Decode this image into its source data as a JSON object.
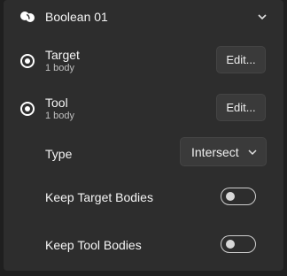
{
  "header": {
    "title": "Boolean 01",
    "icon": "boolean-shapes-icon",
    "collapse_icon": "chevron-down-icon"
  },
  "target": {
    "label": "Target",
    "count": "1 body",
    "button_label": "Edit..."
  },
  "tool": {
    "label": "Tool",
    "count": "1 body",
    "button_label": "Edit..."
  },
  "type": {
    "label": "Type",
    "selected": "Intersect"
  },
  "keep_target": {
    "label": "Keep Target Bodies",
    "on": false
  },
  "keep_tool": {
    "label": "Keep Tool Bodies",
    "on": false
  },
  "colors": {
    "background": "#2d2d2d",
    "control": "#3a3a3a",
    "text": "#f5f5f5",
    "subtext": "#bfbfbf"
  }
}
